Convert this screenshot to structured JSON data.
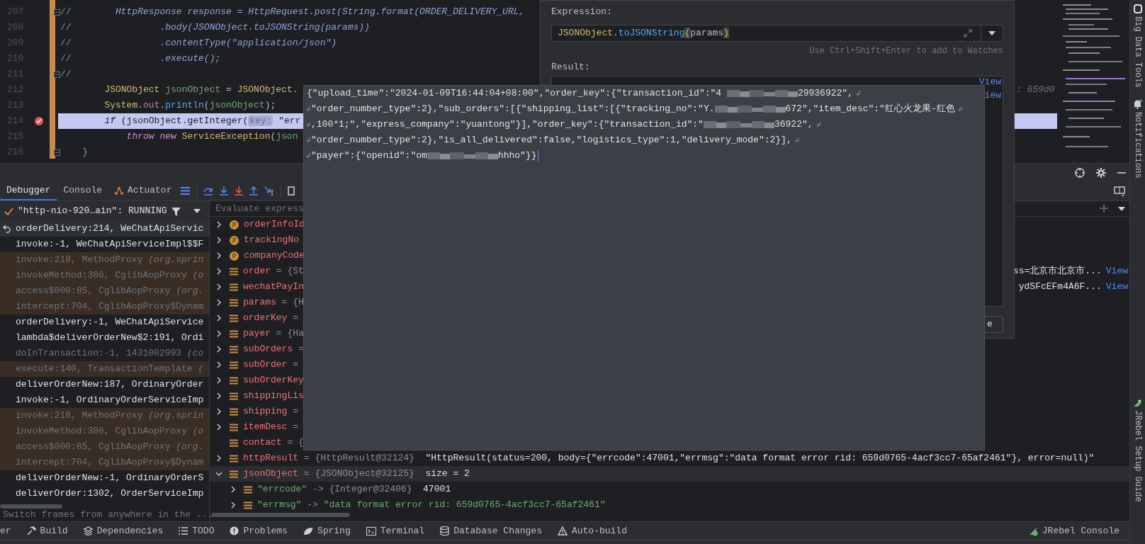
{
  "editor": {
    "lines": [
      {
        "number": "207",
        "fold": true,
        "breakpoint": false,
        "current": false,
        "tokens": [
          {
            "kind": "slash",
            "text": "//"
          },
          {
            "kind": "commented",
            "text": "        HttpResponse response = HttpRequest.post(String.format(ORDER_DELIVERY_URL,"
          }
        ]
      },
      {
        "number": "208",
        "fold": false,
        "breakpoint": false,
        "current": false,
        "tokens": [
          {
            "kind": "slash",
            "text": "//"
          },
          {
            "kind": "commented",
            "text": "                .body(JSONObject.toJSONString(params))"
          }
        ]
      },
      {
        "number": "209",
        "fold": false,
        "breakpoint": false,
        "current": false,
        "tokens": [
          {
            "kind": "slash",
            "text": "//"
          },
          {
            "kind": "commented",
            "text": "                .contentType(\"application/json\")"
          }
        ]
      },
      {
        "number": "210",
        "fold": false,
        "breakpoint": false,
        "current": false,
        "tokens": [
          {
            "kind": "slash",
            "text": "//"
          },
          {
            "kind": "commented",
            "text": "                .execute();"
          }
        ]
      },
      {
        "number": "211",
        "fold": true,
        "breakpoint": false,
        "current": false,
        "tokens": [
          {
            "kind": "slash",
            "text": "//"
          }
        ]
      },
      {
        "number": "212",
        "fold": false,
        "breakpoint": false,
        "current": false,
        "hint": ": 659d0",
        "tokens": [
          {
            "kind": "type",
            "text": "        JSONObject"
          },
          {
            "kind": "var",
            "text": " jsonObject"
          },
          {
            "kind": "plain",
            "text": " = "
          },
          {
            "kind": "type",
            "text": "JSONObject."
          }
        ]
      },
      {
        "number": "213",
        "fold": false,
        "breakpoint": false,
        "current": false,
        "tokens": [
          {
            "kind": "type",
            "text": "        System"
          },
          {
            "kind": "plain",
            "text": "."
          },
          {
            "kind": "field",
            "text": "out"
          },
          {
            "kind": "plain",
            "text": "."
          },
          {
            "kind": "method",
            "text": "println"
          },
          {
            "kind": "plain",
            "text": "("
          },
          {
            "kind": "var",
            "text": "jsonObject"
          },
          {
            "kind": "plain",
            "text": ");"
          }
        ]
      },
      {
        "number": "214",
        "fold": false,
        "breakpoint": true,
        "current": true,
        "tokens": [
          {
            "kind": "keyword",
            "text": "        if"
          },
          {
            "kind": "plain",
            "text": " (jsonObject.getInteger("
          },
          {
            "kind": "param_hint",
            "text": "key:"
          },
          {
            "kind": "string",
            "text": " \"err"
          }
        ]
      },
      {
        "number": "215",
        "fold": false,
        "breakpoint": false,
        "current": false,
        "tokens": [
          {
            "kind": "keyword",
            "text": "            throw new"
          },
          {
            "kind": "type",
            "text": " ServiceException"
          },
          {
            "kind": "plain",
            "text": "("
          },
          {
            "kind": "var",
            "text": "json"
          }
        ]
      },
      {
        "number": "216",
        "fold": true,
        "breakpoint": false,
        "current": false,
        "tokens": [
          {
            "kind": "bracket",
            "text": "    }"
          }
        ]
      }
    ]
  },
  "evaluate": {
    "expression_label": "Expression:",
    "expression": [
      {
        "kind": "type",
        "text": "JSONObject"
      },
      {
        "kind": "plain",
        "text": "."
      },
      {
        "kind": "method",
        "text": "toJSONString"
      },
      {
        "kind": "paren",
        "text": "("
      },
      {
        "kind": "plain",
        "text": "params"
      },
      {
        "kind": "paren",
        "text": ")"
      }
    ],
    "watch_hint": "Use Ctrl+Shift+Enter to add to Watches",
    "result_label": "Result:",
    "result_links": [
      "View",
      "iew"
    ],
    "button": "e"
  },
  "popup": {
    "lines": [
      {
        "wrapped": false,
        "wraps": true,
        "segments": [
          {
            "kind": "text",
            "text": "{\"upload_time\":\"2024-01-09T16:44:04+08:00\",\"order_key\":{\"transaction_id\":\"4 "
          },
          {
            "kind": "redacted"
          },
          {
            "kind": "text",
            "text": "29936922\","
          }
        ]
      },
      {
        "wrapped": true,
        "wraps": true,
        "segments": [
          {
            "kind": "text",
            "text": "\"order_number_type\":2},\"sub_orders\":[{\"shipping_list\":[{\"tracking_no\":\"Y."
          },
          {
            "kind": "redacted"
          },
          {
            "kind": "text",
            "text": "672\",\"item_desc\":\"红心火龙果-红色"
          }
        ]
      },
      {
        "wrapped": true,
        "wraps": true,
        "segments": [
          {
            "kind": "text",
            "text": ",100*1;\",\"express_company\":\"yuantong\"}],\"order_key\":{\"transaction_id\":\""
          },
          {
            "kind": "redacted"
          },
          {
            "kind": "text",
            "text": "36922\","
          }
        ]
      },
      {
        "wrapped": true,
        "wraps": true,
        "segments": [
          {
            "kind": "text",
            "text": "\"order_number_type\":2},\"is_all_delivered\":false,\"logistics_type\":1,\"delivery_mode\":2}],"
          }
        ]
      },
      {
        "wrapped": true,
        "wraps": false,
        "segments": [
          {
            "kind": "text",
            "text": "\"payer\":{\"openid\":\"om"
          },
          {
            "kind": "redacted"
          },
          {
            "kind": "text",
            "text": "hhho\"}}"
          }
        ]
      }
    ]
  },
  "debug_tabs": [
    {
      "label": "Debugger",
      "selected": true
    },
    {
      "label": "Console",
      "selected": false
    },
    {
      "label": "Actuator",
      "selected": false
    }
  ],
  "thread": {
    "label": "\"http-nio-920…ain\": RUNNING"
  },
  "frames": [
    {
      "text": "orderDelivery:214, WeChatApiServic",
      "kind": "current",
      "selected": true
    },
    {
      "text": "invoke:-1, WeChatApiServiceImpl$$F",
      "kind": "app",
      "selected": false
    },
    {
      "text": "invoke:218, MethodProxy",
      "detail": " (org.sprin",
      "kind": "library",
      "selected": false
    },
    {
      "text": "invokeMethod:386, CglibAopProxy",
      "detail": " (o",
      "kind": "library",
      "selected": false
    },
    {
      "text": "access$000:85, CglibAopProxy",
      "detail": " (org.",
      "kind": "library",
      "selected": false
    },
    {
      "text": "intercept:704, CglibAopProxy$Dynam",
      "kind": "library",
      "selected": false
    },
    {
      "text": "orderDelivery:-1, WeChatApiService",
      "kind": "app",
      "selected": false
    },
    {
      "text": "lambda$deliverOrderNew$2:191, Ordi",
      "kind": "app",
      "selected": false
    },
    {
      "text": "doInTransaction:-1, 1431002993",
      "detail": " (co",
      "kind": "generated",
      "selected": false
    },
    {
      "text": "execute:140, TransactionTemplate",
      "detail": " (",
      "kind": "library",
      "selected": false
    },
    {
      "text": "deliverOrderNew:187, OrdinaryOrder",
      "kind": "app",
      "selected": false
    },
    {
      "text": "invoke:-1, OrdinaryOrderServiceImp",
      "kind": "app",
      "selected": false
    },
    {
      "text": "invoke:218, MethodProxy",
      "detail": " (org.sprin",
      "kind": "library",
      "selected": false
    },
    {
      "text": "invokeMethod:386, CglibAopProxy",
      "detail": " (o",
      "kind": "library",
      "selected": false
    },
    {
      "text": "access$000:85, CglibAopProxy",
      "detail": " (org.",
      "kind": "library",
      "selected": false
    },
    {
      "text": "intercept:704, CglibAopProxy$Dynam",
      "kind": "library",
      "selected": false
    },
    {
      "text": "deliverOrderNew:-1, OrdinaryOrderS",
      "kind": "app",
      "selected": false
    },
    {
      "text": "deliverOrder:1302, OrderServiceImp",
      "kind": "app",
      "selected": false
    }
  ],
  "frames_hint": "Switch frames from anywhere in the ...",
  "evaluate_field": {
    "placeholder": "Evaluate express"
  },
  "variables": [
    {
      "name": "orderInfoId",
      "kind": "property",
      "expanded": false,
      "selected": false
    },
    {
      "name": "trackingNo",
      "kind": "property",
      "expanded": false,
      "selected": false
    },
    {
      "name": "companyCode",
      "kind": "property",
      "expanded": false,
      "selected": false
    },
    {
      "name": "order",
      "ref": "= {St",
      "kind": "field",
      "expanded": false,
      "selected": false,
      "tail": "ss=北京市北京市...",
      "link": "View"
    },
    {
      "name": "wechatPayIn",
      "kind": "field",
      "expanded": false,
      "selected": false,
      "tail": "ydSFcEFm4A6F...",
      "link": "View"
    },
    {
      "name": "params",
      "ref": "= {H",
      "kind": "field",
      "expanded": false,
      "selected": false
    },
    {
      "name": "orderKey",
      "ref": "=",
      "kind": "field",
      "expanded": false,
      "selected": false
    },
    {
      "name": "payer",
      "ref": "= {Ha",
      "kind": "field",
      "expanded": false,
      "selected": false
    },
    {
      "name": "subOrders",
      "ref": "=",
      "kind": "field",
      "expanded": false,
      "selected": false
    },
    {
      "name": "subOrder",
      "ref": "=",
      "kind": "field",
      "expanded": false,
      "selected": false
    },
    {
      "name": "subOrderKey",
      "kind": "field",
      "expanded": false,
      "selected": false
    },
    {
      "name": "shippingLis",
      "kind": "field",
      "expanded": false,
      "selected": false
    },
    {
      "name": "shipping",
      "ref": "=",
      "kind": "field",
      "expanded": false,
      "selected": false
    },
    {
      "name": "itemDesc",
      "ref": "=",
      "kind": "field",
      "expanded": false,
      "selected": false
    },
    {
      "name": "contact",
      "ref": "= {",
      "kind": "field",
      "selected": false
    },
    {
      "name": "httpResult",
      "ref": "= {HttpResult@32124}",
      "value": "\"HttpResult(status=200, body={\"errcode\":47001,\"errmsg\":\"data format error rid: 659d0765-4acf3cc7-65af2461\"}, error=null)\"",
      "is_string": false,
      "kind": "field",
      "expanded": false,
      "selected": false
    },
    {
      "name": "jsonObject",
      "ref": "= {JSONObject@32125}",
      "value": "size = 2",
      "is_string": false,
      "kind": "field",
      "expanded": true,
      "selected": true,
      "children": [
        {
          "name": "\"errcode\"",
          "ref": "-> {Integer@32406}",
          "value": "47001",
          "is_string": false,
          "kind": "entry",
          "expanded": false,
          "selected": false
        },
        {
          "name": "\"errmsg\"",
          "ref": "->",
          "value": "\"data format error rid: 659d0765-4acf3cc7-65af2461\"",
          "is_string": true,
          "kind": "entry",
          "expanded": false,
          "selected": false
        }
      ]
    }
  ],
  "bottom_tools": [
    {
      "label": "er",
      "kind": "partial"
    },
    {
      "label": "Build",
      "kind": "build"
    },
    {
      "label": "Dependencies",
      "kind": "dependencies"
    },
    {
      "label": "TODO",
      "kind": "todo"
    },
    {
      "label": "Problems",
      "kind": "problems"
    },
    {
      "label": "Spring",
      "kind": "spring"
    },
    {
      "label": "Terminal",
      "kind": "terminal"
    },
    {
      "label": "Database Changes",
      "kind": "database"
    },
    {
      "label": "Auto-build",
      "kind": "autobuild"
    }
  ],
  "right_tool": "JRebel Console",
  "side_strip": [
    {
      "label": "Big Data Tools",
      "kind": "bigdata"
    },
    {
      "label": "Notifications",
      "kind": "bell"
    },
    {
      "label": "JRebel Setup Guide",
      "kind": "rocket"
    }
  ]
}
